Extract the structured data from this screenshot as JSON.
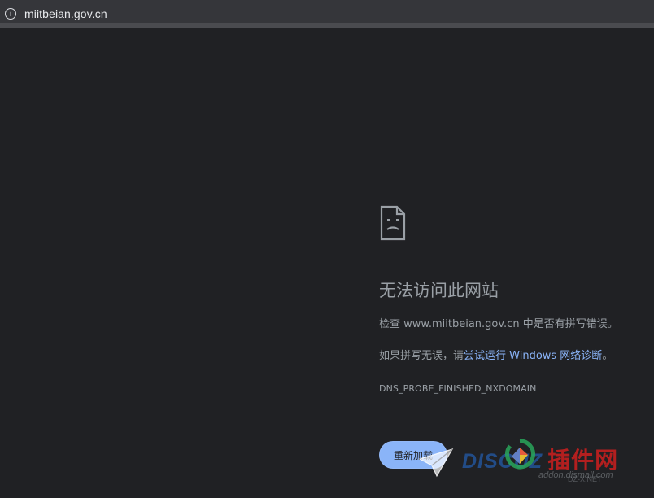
{
  "browser": {
    "url": "miitbeian.gov.cn",
    "icon": "info-icon"
  },
  "error_page": {
    "icon": "sad-document-icon",
    "title": "无法访问此网站",
    "line1": "检查 www.miitbeian.gov.cn 中是否有拼写错误。",
    "line2_prefix": "如果拼写无误，请",
    "line2_link": "尝试运行 Windows 网络诊断",
    "line2_suffix": "。",
    "error_code": "DNS_PROBE_FINISHED_NXDOMAIN",
    "reload_label": "重新加载"
  },
  "colors": {
    "background": "#202124",
    "text_secondary": "#9aa0a6",
    "link": "#8ab4f8",
    "button": "#8ab4f8"
  },
  "watermark": {
    "brand_latin": "DISCUZ",
    "brand_cn": "插件网",
    "subtitle": "addon.dismall.com",
    "tiny": "DZ-X.NET"
  }
}
